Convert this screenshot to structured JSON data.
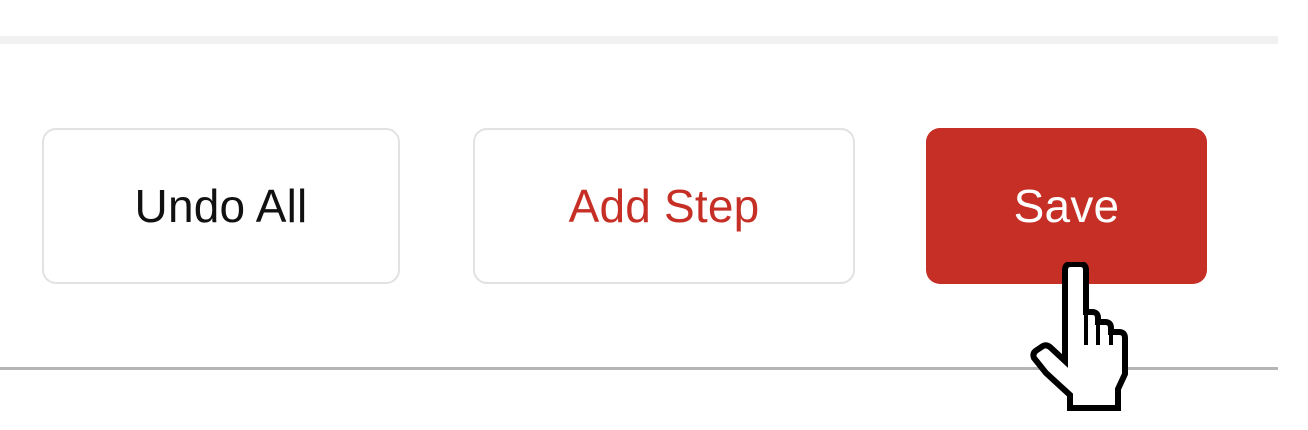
{
  "actions": {
    "undo_all_label": "Undo All",
    "add_step_label": "Add Step",
    "save_label": "Save"
  },
  "colors": {
    "accent": "#c62f25",
    "outline_border": "#e2e2e2",
    "text_dark": "#111111",
    "text_light": "#ffffff"
  },
  "cursor": {
    "icon": "hand-pointer-icon"
  }
}
